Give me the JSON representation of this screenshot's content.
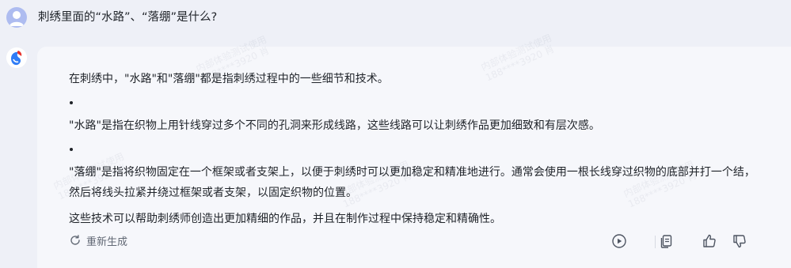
{
  "user": {
    "question": "刺绣里面的“水路”、“落绷”是什么?",
    "avatar_icon": "user-avatar-icon"
  },
  "bot": {
    "avatar_icon": "bot-logo-icon"
  },
  "answer": {
    "intro": "在刺绣中，\"水路\"和\"落绷\"都是指刺绣过程中的一些细节和技术。",
    "items": [
      "\"水路\"是指在织物上用针线穿过多个不同的孔洞来形成线路，这些线路可以让刺绣作品更加细致和有层次感。",
      "\"落绷\"是指将织物固定在一个框架或者支架上，以便于刺绣时可以更加稳定和精准地进行。通常会使用一根长线穿过织物的底部并打一个结，然后将线头拉紧并绕过框架或者支架，以固定织物的位置。"
    ],
    "closing": "这些技术可以帮助刺绣师创造出更加精细的作品，并且在制作过程中保持稳定和精确性。"
  },
  "actions": {
    "regenerate_label": "重新生成",
    "regenerate_icon": "refresh-icon",
    "play_icon": "play-icon",
    "copy_icon": "copy-icon",
    "like_icon": "thumbs-up-icon",
    "dislike_icon": "thumbs-down-icon"
  },
  "watermark": {
    "line1": "内部体验测试使用",
    "line2": "188****3920 肖"
  },
  "colors": {
    "page_bg": "#eef0f7",
    "card_bg": "#f6f7fb",
    "text": "#1f2329",
    "muted": "#626975",
    "user_avatar": "#aebcf0",
    "bot_red": "#e8322c",
    "bot_blue": "#2f7cf6"
  }
}
